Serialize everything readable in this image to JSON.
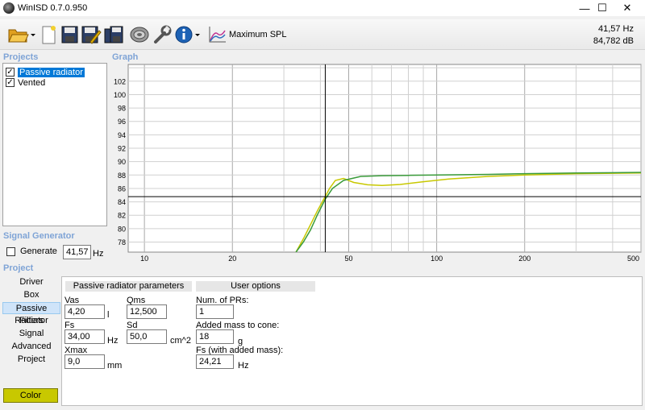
{
  "window": {
    "title": "WinISD 0.7.0.950",
    "minimize": "—",
    "maximize": "☐",
    "close": "✕"
  },
  "toolbar": {
    "graph_selector": "Maximum SPL",
    "readout_freq": "41,57 Hz",
    "readout_level": "84,782 dB"
  },
  "projects": {
    "header": "Projects",
    "items": [
      {
        "label": "Passive radiator",
        "checked": true,
        "selected": true
      },
      {
        "label": "Vented",
        "checked": true,
        "selected": false
      }
    ]
  },
  "signal_generator": {
    "header": "Signal Generator",
    "generate_label": "Generate",
    "generate_checked": false,
    "frequency": "41,57",
    "unit": "Hz"
  },
  "graph": {
    "header": "Graph"
  },
  "chart_data": {
    "type": "line",
    "title": "",
    "xlabel": "",
    "ylabel": "",
    "xscale": "log",
    "xlim": [
      8.8,
      500
    ],
    "ylim": [
      76.5,
      104.5
    ],
    "x_ticks": [
      10,
      20,
      50,
      100,
      200,
      500
    ],
    "y_ticks": [
      78,
      80,
      82,
      84,
      86,
      88,
      90,
      92,
      94,
      96,
      98,
      100,
      102
    ],
    "cursor": {
      "x": 41.57,
      "y": 84.782
    },
    "grid": true,
    "series": [
      {
        "color": "#c8c800",
        "x": [
          33,
          35,
          37,
          39,
          41.57,
          43,
          45,
          48,
          52,
          58,
          65,
          75,
          90,
          110,
          150,
          200,
          300,
          500
        ],
        "y": [
          76.5,
          78.5,
          80.6,
          82.6,
          84.8,
          86.0,
          87.2,
          87.5,
          86.9,
          86.55,
          86.45,
          86.6,
          87.0,
          87.4,
          87.8,
          88.0,
          88.2,
          88.3
        ]
      },
      {
        "color": "#3a9b3a",
        "x": [
          33,
          35,
          37,
          39,
          41.57,
          44,
          48,
          55,
          65,
          80,
          100,
          150,
          200,
          300,
          500
        ],
        "y": [
          76.5,
          78.0,
          79.8,
          82.0,
          84.4,
          86.0,
          87.2,
          87.8,
          87.9,
          87.95,
          88.0,
          88.1,
          88.2,
          88.3,
          88.4
        ]
      }
    ]
  },
  "project": {
    "header": "Project",
    "nav": [
      "Driver",
      "Box",
      "Passive Radiator",
      "Filters",
      "Signal",
      "Advanced",
      "Project"
    ],
    "nav_selected": "Passive Radiator",
    "color_button": "Color"
  },
  "pr_params": {
    "header": "Passive radiator parameters",
    "vas_label": "Vas",
    "vas": "4,20",
    "vas_unit": "l",
    "qms_label": "Qms",
    "qms": "12,500",
    "fs_label": "Fs",
    "fs": "34,00",
    "fs_unit": "Hz",
    "sd_label": "Sd",
    "sd": "50,0",
    "sd_unit": "cm^2",
    "xmax_label": "Xmax",
    "xmax": "9,0",
    "xmax_unit": "mm"
  },
  "user_options": {
    "header": "User options",
    "num_prs_label": "Num. of PRs:",
    "num_prs": "1",
    "added_mass_label": "Added mass to cone:",
    "added_mass": "18",
    "added_mass_unit": "g",
    "fs_added_label": "Fs (with added mass):",
    "fs_added": "24,21",
    "fs_added_unit": "Hz"
  }
}
